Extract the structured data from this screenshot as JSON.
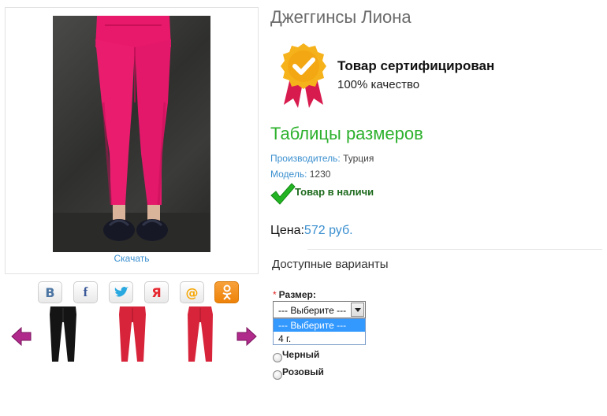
{
  "gallery": {
    "download_label": "Скачать",
    "social_icons": [
      "vk-icon",
      "facebook-icon",
      "twitter-icon",
      "odnoklassniki-alt-icon",
      "mailru-icon",
      "odnoklassniki-icon"
    ],
    "thumbnails": [
      {
        "name": "thumb-black-jeggings",
        "color": "#141414"
      },
      {
        "name": "thumb-red-jeggings-1",
        "color": "#d8243a"
      },
      {
        "name": "thumb-red-jeggings-2",
        "color": "#d8243a"
      }
    ]
  },
  "product": {
    "title": "Джеггинсы Лиона",
    "certified_title": "Товар сертифицирован",
    "certified_sub": "100% качество",
    "size_table_link": "Таблицы размеров",
    "manufacturer_key": "Производитель:",
    "manufacturer_value": "Турция",
    "model_key": "Модель:",
    "model_value": "1230",
    "stock_status": "Товар в наличи",
    "price_label": "Цена:",
    "price_value": "572 руб."
  },
  "options": {
    "heading": "Доступные варианты",
    "size_label": "Размер:",
    "required_mark": "*",
    "select_value": "--- Выберите ---",
    "dropdown_options": [
      "--- Выберите ---",
      "4 г."
    ],
    "radio_options": [
      "Черный",
      "Розовый"
    ]
  },
  "colors": {
    "accent_blue": "#3a8fcf",
    "green_link": "#2db12d",
    "product_pink": "#e8186a"
  }
}
